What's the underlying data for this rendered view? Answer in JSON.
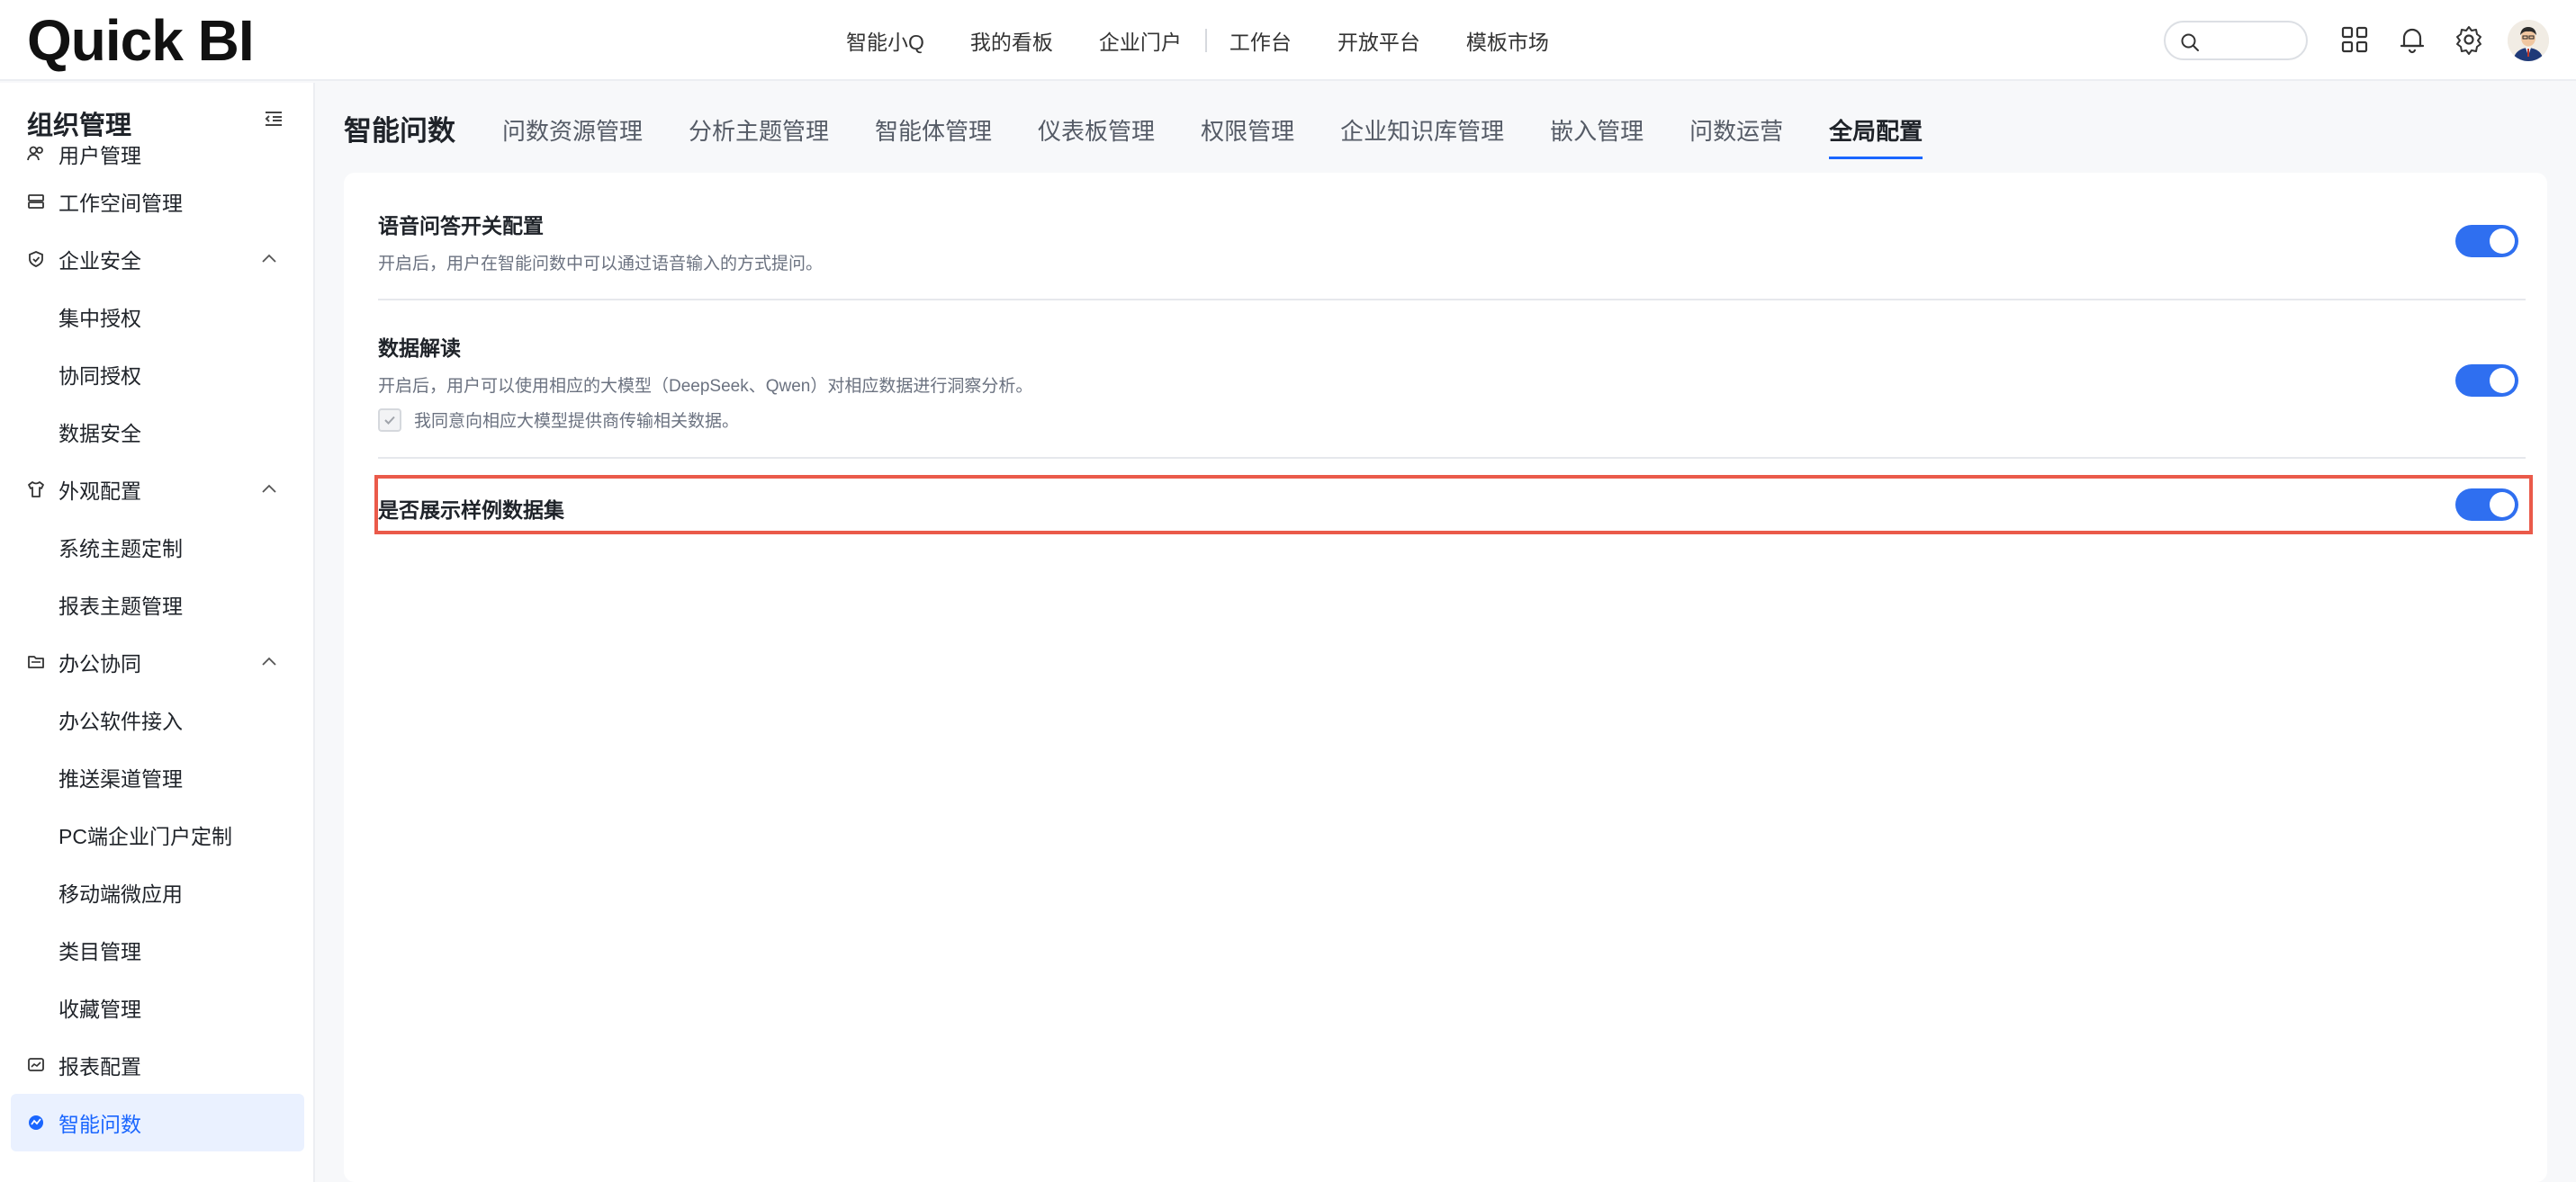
{
  "app": {
    "logo_text": "Quick BI"
  },
  "topnav": {
    "items": [
      "智能小Q",
      "我的看板",
      "企业门户",
      "工作台",
      "开放平台",
      "模板市场"
    ]
  },
  "search": {
    "placeholder": ""
  },
  "sidebar": {
    "title": "组织管理",
    "items": [
      {
        "label": "用户管理",
        "level": 1,
        "icon": "users-icon"
      },
      {
        "label": "工作空间管理",
        "level": 1,
        "icon": "workspace-icon"
      },
      {
        "label": "企业安全",
        "level": 1,
        "icon": "shield-icon",
        "expanded": true
      },
      {
        "label": "集中授权",
        "level": 2
      },
      {
        "label": "协同授权",
        "level": 2
      },
      {
        "label": "数据安全",
        "level": 2
      },
      {
        "label": "外观配置",
        "level": 1,
        "icon": "shirt-icon",
        "expanded": true
      },
      {
        "label": "系统主题定制",
        "level": 2
      },
      {
        "label": "报表主题管理",
        "level": 2
      },
      {
        "label": "办公协同",
        "level": 1,
        "icon": "folder-icon",
        "expanded": true
      },
      {
        "label": "办公软件接入",
        "level": 2
      },
      {
        "label": "推送渠道管理",
        "level": 2
      },
      {
        "label": "PC端企业门户定制",
        "level": 2
      },
      {
        "label": "移动端微应用",
        "level": 2
      },
      {
        "label": "类目管理",
        "level": 2
      },
      {
        "label": "收藏管理",
        "level": 2
      },
      {
        "label": "报表配置",
        "level": 1,
        "icon": "report-icon"
      },
      {
        "label": "智能问数",
        "level": 1,
        "icon": "smart-query-icon",
        "active": true
      }
    ]
  },
  "tabs": {
    "main": "智能问数",
    "items": [
      "问数资源管理",
      "分析主题管理",
      "智能体管理",
      "仪表板管理",
      "权限管理",
      "企业知识库管理",
      "嵌入管理",
      "问数运营",
      "全局配置"
    ],
    "active": "全局配置"
  },
  "settings": {
    "voice": {
      "title": "语音问答开关配置",
      "desc": "开启后，用户在智能问数中可以通过语音输入的方式提问。",
      "enabled": true
    },
    "interpret": {
      "title": "数据解读",
      "desc": "开启后，用户可以使用相应的大模型（DeepSeek、Qwen）对相应数据进行洞察分析。",
      "consent": "我同意向相应大模型提供商传输相关数据。",
      "consent_checked": true,
      "enabled": true
    },
    "sample": {
      "title": "是否展示样例数据集",
      "enabled": true
    }
  },
  "colors": {
    "accent": "#1a66ff",
    "toggle_on": "#2f6ff0",
    "highlight_border": "#ea5a4a"
  }
}
